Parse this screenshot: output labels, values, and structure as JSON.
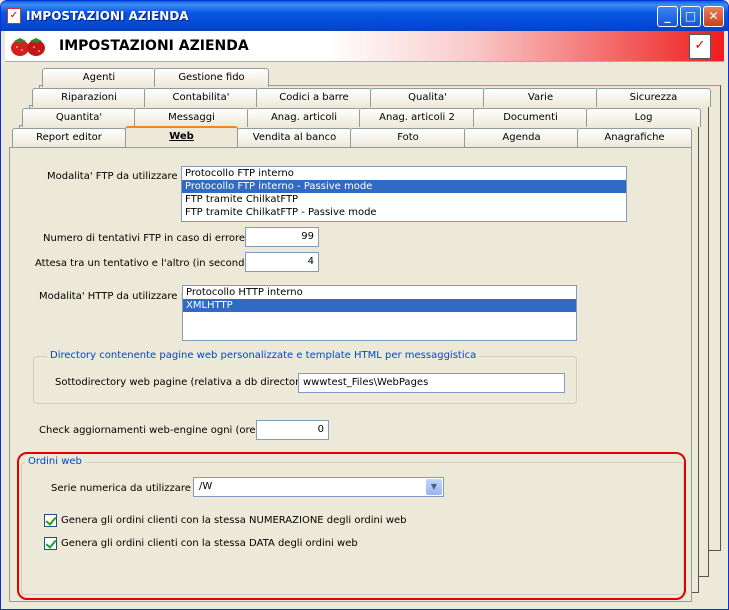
{
  "window": {
    "title": "IMPOSTAZIONI AZIENDA",
    "header_title": "IMPOSTAZIONI AZIENDA",
    "minimize_glyph": "_",
    "maximize_glyph": "□",
    "close_glyph": "✕"
  },
  "tabs": {
    "row1": [
      "Agenti",
      "Gestione fido"
    ],
    "row2": [
      "Riparazioni",
      "Contabilita'",
      "Codici a barre",
      "Qualita'",
      "Varie",
      "Sicurezza"
    ],
    "row3": [
      "Quantita'",
      "Messaggi",
      "Anag. articoli",
      "Anag. articoli 2",
      "Documenti",
      "Log"
    ],
    "row4": [
      "Report editor",
      "Web",
      "Vendita al banco",
      "Foto",
      "Agenda",
      "Anagrafiche"
    ],
    "active": "Web"
  },
  "web": {
    "ftp_mode_label": "Modalita' FTP da utilizzare :",
    "ftp_options": [
      "Protocollo FTP interno",
      "Protocollo FTP interno - Passive mode",
      "FTP tramite ChilkatFTP",
      "FTP tramite ChilkatFTP - Passive mode"
    ],
    "ftp_selected_index": 1,
    "ftp_retries_label": "Numero di tentativi FTP in caso di errore :",
    "ftp_retries_value": "99",
    "wait_label": "Attesa tra un tentativo e l'altro (in secondi) :",
    "wait_value": "4",
    "http_mode_label": "Modalita' HTTP da utilizzare :",
    "http_options": [
      "Protocollo HTTP interno",
      "XMLHTTP"
    ],
    "http_selected_index": 1,
    "dir_group_label": "Directory contenente pagine web personalizzate e template HTML per messaggistica",
    "subdir_label": "Sottodirectory web pagine (relativa a db directory) :",
    "subdir_value": "wwwtest_Files\\WebPages",
    "check_updates_label": "Check aggiornamenti web-engine ogni (ore) :",
    "check_updates_value": "0",
    "orders_group_label": "Ordini web",
    "series_label": "Serie numerica da utilizzare :",
    "series_value": "/W",
    "checkbox1_label": "Genera gli ordini clienti con la stessa NUMERAZIONE degli ordini web",
    "checkbox1_checked": true,
    "checkbox2_label": "Genera gli ordini clienti con la stessa DATA degli ordini web",
    "checkbox2_checked": true
  }
}
